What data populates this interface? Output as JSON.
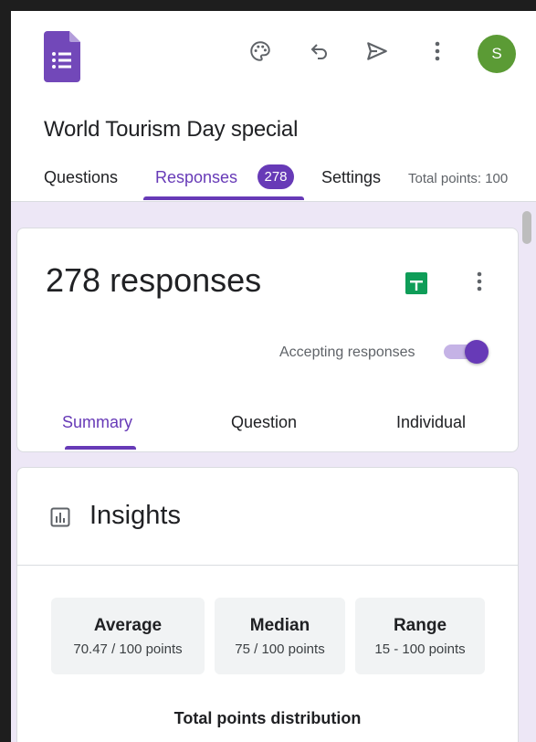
{
  "header": {
    "form_title": "World Tourism Day special",
    "avatar_letter": "S",
    "tabs": [
      {
        "label": "Questions"
      },
      {
        "label": "Responses",
        "badge": "278"
      },
      {
        "label": "Settings"
      }
    ],
    "total_points": "Total points: 100"
  },
  "responses": {
    "count_title": "278 responses",
    "accepting_label": "Accepting responses",
    "accepting": true,
    "subtabs": [
      {
        "label": "Summary"
      },
      {
        "label": "Question"
      },
      {
        "label": "Individual"
      }
    ]
  },
  "insights": {
    "title": "Insights",
    "stats": [
      {
        "label": "Average",
        "value": "70.47 / 100 points"
      },
      {
        "label": "Median",
        "value": "75 / 100 points"
      },
      {
        "label": "Range",
        "value": "15 - 100 points"
      }
    ],
    "distribution_title": "Total points distribution"
  },
  "colors": {
    "accent": "#673ab7",
    "avatar": "#5b9b35",
    "sheets": "#0f9d58",
    "background": "#ede7f6"
  },
  "icons": [
    "forms-app-icon",
    "palette-icon",
    "undo-icon",
    "send-icon",
    "more-vert-icon",
    "sheets-icon",
    "insights-chart-icon"
  ]
}
